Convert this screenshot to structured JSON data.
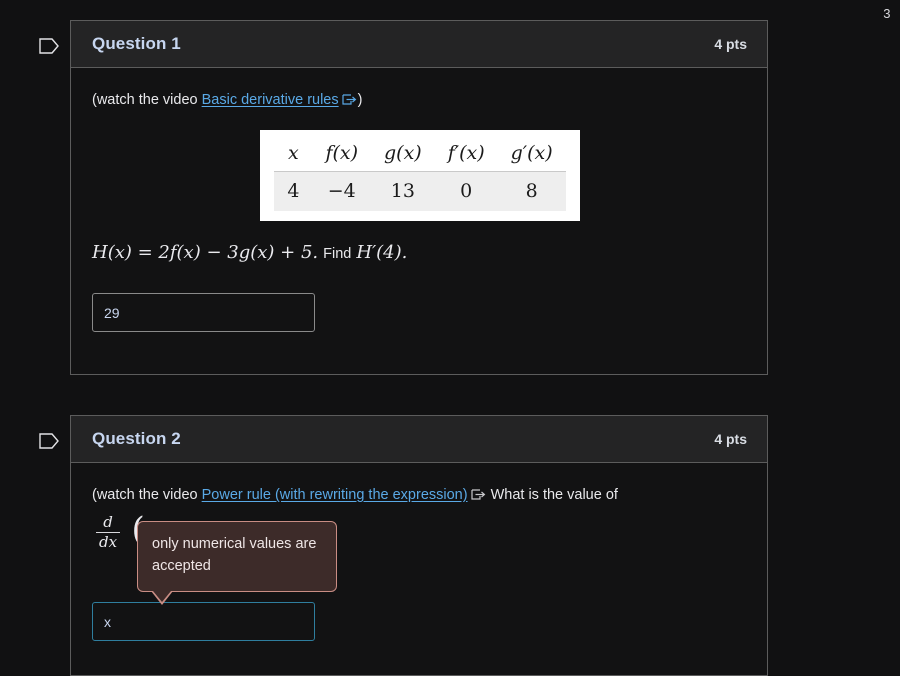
{
  "page": {
    "indicator": "3",
    "background_color": "#111112"
  },
  "questions": [
    {
      "id": "q1",
      "flag_icon": "flag-outline-icon",
      "title": "Question 1",
      "points": "4 pts",
      "prompt_prefix": "(watch the video ",
      "link_text": "Basic derivative rules",
      "link_icon": "external-link-icon",
      "prompt_suffix": ")",
      "table": {
        "headers": [
          "x",
          "f(x)",
          "g(x)",
          "f′(x)",
          "g′(x)"
        ],
        "rows": [
          [
            "4",
            "−4",
            "13",
            "0",
            "8"
          ]
        ]
      },
      "formula": {
        "expression": "H(x) = 2f(x) − 3g(x) + 5.",
        "instruction": "Find",
        "target": "H′(4)."
      },
      "answer": {
        "value": "29",
        "placeholder": "",
        "focused": false
      }
    },
    {
      "id": "q2",
      "flag_icon": "flag-outline-icon",
      "title": "Question 2",
      "points": "4 pts",
      "prompt_prefix": "(watch the video ",
      "link_text": "Power rule (with rewriting the expression)",
      "link_icon": "external-link-icon",
      "prompt_suffix": " What is the value of",
      "derivative": {
        "numerator": "d",
        "denominator": "dx",
        "open_paren": "("
      },
      "tooltip": {
        "text": "only numerical values are accepted",
        "background_color": "#3d2b29",
        "border_color": "#c98d84"
      },
      "answer": {
        "value": "x",
        "placeholder": "",
        "focused": true
      }
    }
  ]
}
